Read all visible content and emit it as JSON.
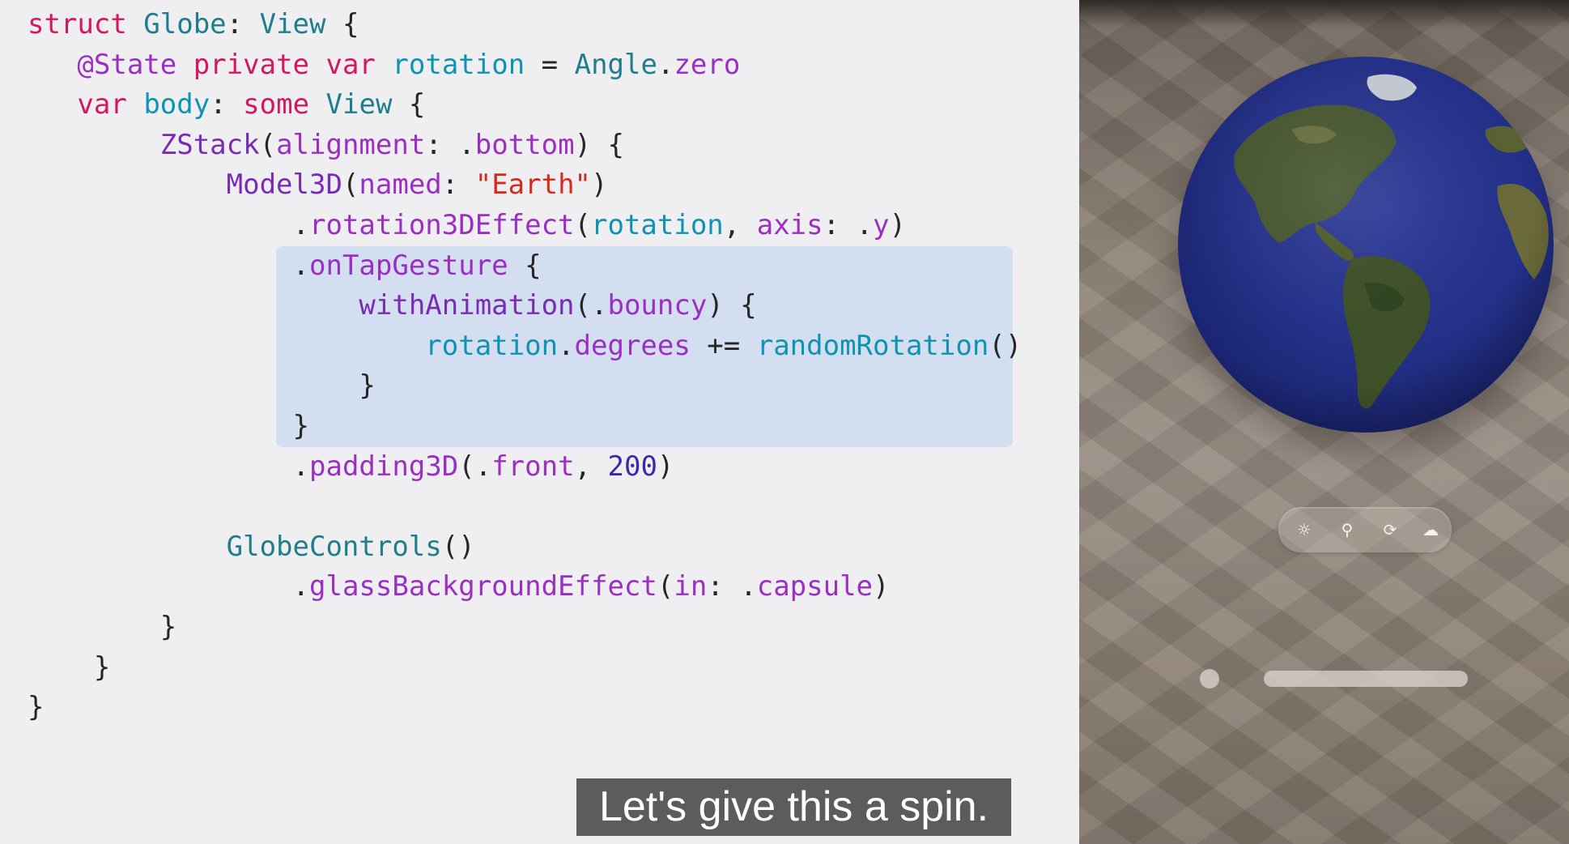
{
  "code_lines": [
    [
      {
        "t": "struct ",
        "c": "kw"
      },
      {
        "t": "Globe",
        "c": "type"
      },
      {
        "t": ": ",
        "c": "pl"
      },
      {
        "t": "View",
        "c": "type"
      },
      {
        "t": " {",
        "c": "pl"
      }
    ],
    [
      {
        "t": "   ",
        "c": "pl"
      },
      {
        "t": "@State",
        "c": "attr"
      },
      {
        "t": " ",
        "c": "pl"
      },
      {
        "t": "private",
        "c": "kw"
      },
      {
        "t": " ",
        "c": "pl"
      },
      {
        "t": "var",
        "c": "kw"
      },
      {
        "t": " ",
        "c": "pl"
      },
      {
        "t": "rotation",
        "c": "prop"
      },
      {
        "t": " = ",
        "c": "pl"
      },
      {
        "t": "Angle",
        "c": "type"
      },
      {
        "t": ".",
        "c": "pl"
      },
      {
        "t": "zero",
        "c": "mem"
      }
    ],
    [
      {
        "t": "   ",
        "c": "pl"
      },
      {
        "t": "var",
        "c": "kw"
      },
      {
        "t": " ",
        "c": "pl"
      },
      {
        "t": "body",
        "c": "prop"
      },
      {
        "t": ": ",
        "c": "pl"
      },
      {
        "t": "some",
        "c": "kw"
      },
      {
        "t": " ",
        "c": "pl"
      },
      {
        "t": "View",
        "c": "type"
      },
      {
        "t": " {",
        "c": "pl"
      }
    ],
    [
      {
        "t": "        ",
        "c": "pl"
      },
      {
        "t": "ZStack",
        "c": "fn"
      },
      {
        "t": "(",
        "c": "pl"
      },
      {
        "t": "alignment",
        "c": "mem"
      },
      {
        "t": ": .",
        "c": "pl"
      },
      {
        "t": "bottom",
        "c": "mem"
      },
      {
        "t": ") {",
        "c": "pl"
      }
    ],
    [
      {
        "t": "            ",
        "c": "pl"
      },
      {
        "t": "Model3D",
        "c": "fn"
      },
      {
        "t": "(",
        "c": "pl"
      },
      {
        "t": "named",
        "c": "mem"
      },
      {
        "t": ": ",
        "c": "pl"
      },
      {
        "t": "\"Earth\"",
        "c": "str"
      },
      {
        "t": ")",
        "c": "pl"
      }
    ],
    [
      {
        "t": "                .",
        "c": "pl"
      },
      {
        "t": "rotation3DEffect",
        "c": "mem"
      },
      {
        "t": "(",
        "c": "pl"
      },
      {
        "t": "rotation",
        "c": "prop"
      },
      {
        "t": ", ",
        "c": "pl"
      },
      {
        "t": "axis",
        "c": "mem"
      },
      {
        "t": ": .",
        "c": "pl"
      },
      {
        "t": "y",
        "c": "mem"
      },
      {
        "t": ")",
        "c": "pl"
      }
    ],
    [
      {
        "t": "                .",
        "c": "pl"
      },
      {
        "t": "onTapGesture",
        "c": "mem"
      },
      {
        "t": " {",
        "c": "pl"
      }
    ],
    [
      {
        "t": "                    ",
        "c": "pl"
      },
      {
        "t": "withAnimation",
        "c": "fn"
      },
      {
        "t": "(.",
        "c": "pl"
      },
      {
        "t": "bouncy",
        "c": "mem"
      },
      {
        "t": ") {",
        "c": "pl"
      }
    ],
    [
      {
        "t": "                        ",
        "c": "pl"
      },
      {
        "t": "rotation",
        "c": "prop"
      },
      {
        "t": ".",
        "c": "pl"
      },
      {
        "t": "degrees",
        "c": "mem"
      },
      {
        "t": " += ",
        "c": "pl"
      },
      {
        "t": "randomRotation",
        "c": "prop"
      },
      {
        "t": "()",
        "c": "pl"
      }
    ],
    [
      {
        "t": "                    }",
        "c": "pl"
      }
    ],
    [
      {
        "t": "                }",
        "c": "pl"
      }
    ],
    [
      {
        "t": "                .",
        "c": "pl"
      },
      {
        "t": "padding3D",
        "c": "mem"
      },
      {
        "t": "(.",
        "c": "pl"
      },
      {
        "t": "front",
        "c": "mem"
      },
      {
        "t": ", ",
        "c": "pl"
      },
      {
        "t": "200",
        "c": "num"
      },
      {
        "t": ")",
        "c": "pl"
      }
    ],
    [
      {
        "t": "",
        "c": "pl"
      }
    ],
    [
      {
        "t": "            ",
        "c": "pl"
      },
      {
        "t": "GlobeControls",
        "c": "type"
      },
      {
        "t": "()",
        "c": "pl"
      }
    ],
    [
      {
        "t": "                .",
        "c": "pl"
      },
      {
        "t": "glassBackgroundEffect",
        "c": "mem"
      },
      {
        "t": "(",
        "c": "pl"
      },
      {
        "t": "in",
        "c": "mem"
      },
      {
        "t": ": .",
        "c": "pl"
      },
      {
        "t": "capsule",
        "c": "mem"
      },
      {
        "t": ")",
        "c": "pl"
      }
    ],
    [
      {
        "t": "        }",
        "c": "pl"
      }
    ],
    [
      {
        "t": "    }",
        "c": "pl"
      }
    ],
    [
      {
        "t": "}",
        "c": "pl"
      }
    ]
  ],
  "caption": "Let's give this a spin.",
  "globe_controls": [
    {
      "icon": "sun-icon",
      "glyph": "☼"
    },
    {
      "icon": "pin-icon",
      "glyph": "⚲"
    },
    {
      "icon": "rotate-icon",
      "glyph": "⟳"
    },
    {
      "icon": "cloud-sun-icon",
      "glyph": "☁"
    }
  ],
  "colors": {
    "code_background": "#efeff2",
    "highlight": "#d3def0",
    "keyword": "#d4185f",
    "type": "#1f7d8c",
    "function": "#7a2bb6",
    "member": "#9b2fc1",
    "property": "#0f93b3",
    "string": "#d62b1b",
    "number": "#3b2aa6",
    "caption_background": "#5c5c5c"
  }
}
